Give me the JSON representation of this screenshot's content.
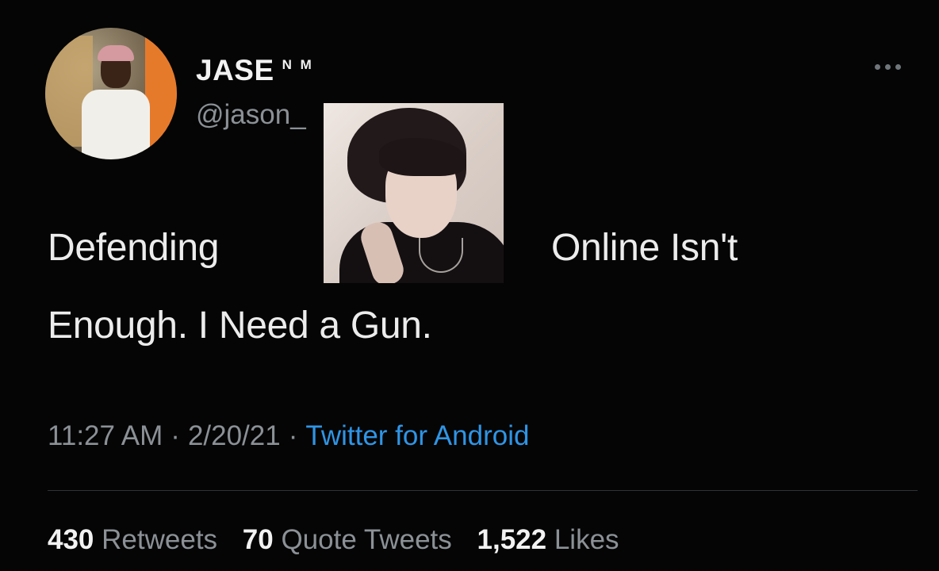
{
  "user": {
    "display_name": "JASE",
    "name_suffix": "N M",
    "handle": "@jason_"
  },
  "tweet": {
    "text_line1_start": "Defending",
    "text_line1_end": "Online Isn't",
    "text_line2": "Enough. I Need a Gun."
  },
  "meta": {
    "time": "11:27 AM",
    "separator": "·",
    "date": "2/20/21",
    "source": "Twitter for Android"
  },
  "stats": {
    "retweets_count": "430",
    "retweets_label": "Retweets",
    "quotes_count": "70",
    "quotes_label": "Quote Tweets",
    "likes_count": "1,522",
    "likes_label": "Likes"
  },
  "colors": {
    "background": "#050505",
    "link": "#2f95e6",
    "secondary_text": "#8b9196"
  },
  "icons": {
    "more": "more-options-icon"
  }
}
